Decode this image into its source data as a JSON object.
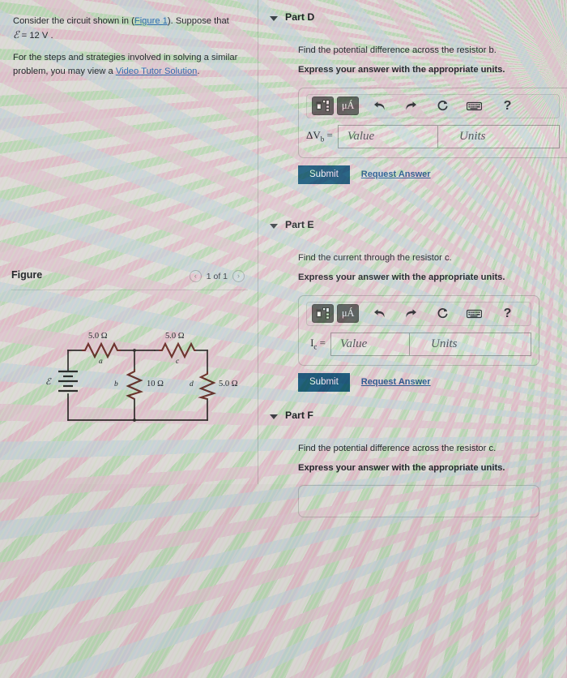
{
  "problem": {
    "line1_pre": "Consider the circuit shown in (",
    "line1_link": "Figure 1",
    "line1_post": "). Suppose that",
    "line2_sym": "ℰ",
    "line2_rest": " = 12  V .",
    "para2_pre": "For the steps and strategies involved in solving a similar problem, you may view a ",
    "para2_link": "Video Tutor Solution",
    "para2_post": "."
  },
  "figure": {
    "title": "Figure",
    "prev_icon": "‹",
    "next_icon": "›",
    "counter": "1 of 1",
    "circuit": {
      "emf_label": "ℰ",
      "resistors": [
        {
          "name": "a",
          "value": "5.0 Ω",
          "orientation": "horizontal"
        },
        {
          "name": "b",
          "value": "10 Ω",
          "orientation": "vertical"
        },
        {
          "name": "c",
          "value": "5.0 Ω",
          "orientation": "horizontal"
        },
        {
          "name": "d",
          "value": "5.0 Ω",
          "orientation": "vertical"
        }
      ]
    }
  },
  "toolbar": {
    "template_icon": "template-matrix-icon",
    "units_label": "μÁ",
    "undo_icon": "↩",
    "redo_icon": "↪",
    "reset_icon": "⟳",
    "keyboard_icon": "keyboard-icon",
    "help_icon": "?"
  },
  "fields": {
    "value_placeholder": "Value",
    "units_placeholder": "Units",
    "value_current": "",
    "units_current": ""
  },
  "actions": {
    "submit_label": "Submit",
    "request_answer_label": "Request Answer"
  },
  "parts": [
    {
      "id": "D",
      "title": "Part D",
      "question": "Find the potential difference across the resistor b.",
      "question_italic_tail": "b",
      "instruction": "Express your answer with the appropriate units.",
      "answer_label_main": "ΔV",
      "answer_label_sub": "b",
      "answer_label_eq": " ="
    },
    {
      "id": "E",
      "title": "Part E",
      "question": "Find the current through the resistor c.",
      "question_italic_tail": "c",
      "instruction": "Express your answer with the appropriate units.",
      "answer_label_main": "I",
      "answer_label_sub": "c",
      "answer_label_eq": " ="
    },
    {
      "id": "F",
      "title": "Part F",
      "question": "Find the potential difference across the resistor c.",
      "question_italic_tail": "c",
      "instruction": "Express your answer with the appropriate units.",
      "answer_label_main": "",
      "answer_label_sub": "",
      "answer_label_eq": ""
    }
  ],
  "colors": {
    "submit_bg": "#1a5b7d",
    "link": "#2f6fb5",
    "resistor_body": "#6b2f28",
    "wire": "#2b2b28",
    "page_bg": "#dddbd7"
  }
}
